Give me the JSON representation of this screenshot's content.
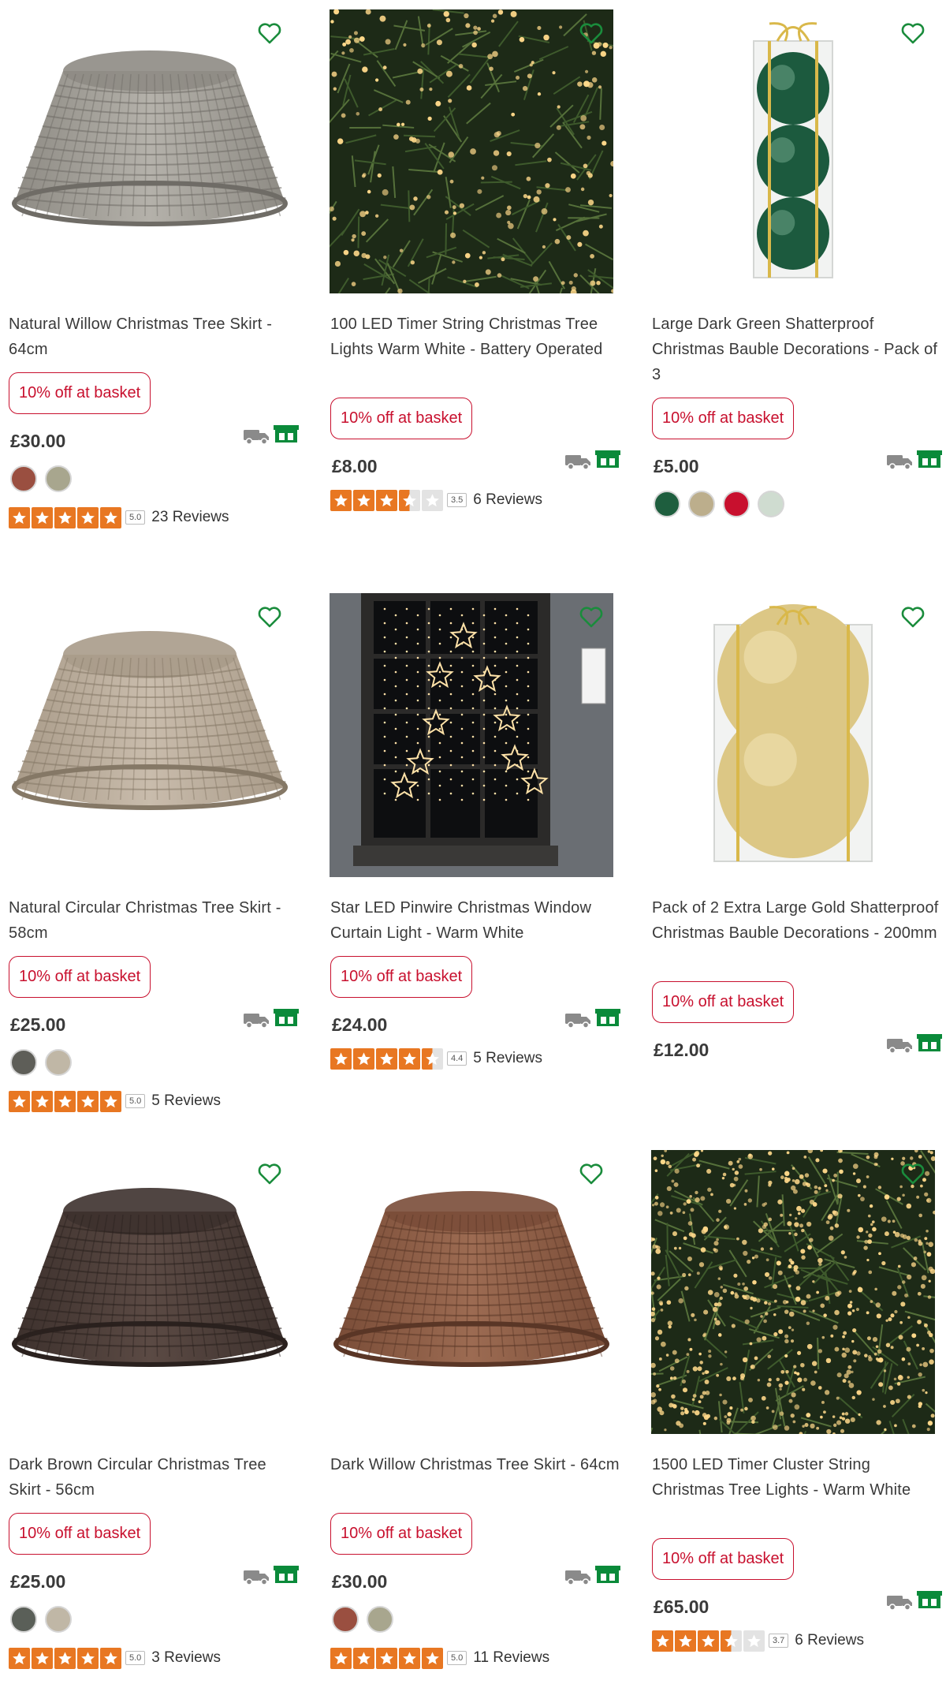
{
  "products": [
    {
      "title": "Natural Willow Christmas Tree Skirt - 64cm",
      "promo": "10% off at basket",
      "price": "£30.00",
      "swatches": [
        "#9a4f40",
        "#a8a68e"
      ],
      "rating": {
        "value": "5.0",
        "stars": 5,
        "reviews": "23 Reviews"
      },
      "image": "grey-wicker-skirt"
    },
    {
      "title": "100 LED Timer String Christmas Tree Lights Warm White - Battery Operated",
      "promo": "10% off at basket",
      "price": "£8.00",
      "swatches": [],
      "rating": {
        "value": "3.5",
        "stars": 3.5,
        "reviews": "6 Reviews"
      },
      "image": "tree-string-lights"
    },
    {
      "title": "Large Dark Green Shatterproof Christmas Bauble Decorations - Pack of 3",
      "promo": "10% off at basket",
      "price": "£5.00",
      "swatches": [
        "#1e5e3e",
        "#bcae8c",
        "#c8102e",
        "#cfdcd0"
      ],
      "rating": null,
      "image": "green-baubles-box"
    },
    {
      "title": "Natural Circular Christmas Tree Skirt - 58cm",
      "promo": "10% off at basket",
      "price": "£25.00",
      "swatches": [
        "#5e5e58",
        "#c0b7a6"
      ],
      "rating": {
        "value": "5.0",
        "stars": 5,
        "reviews": "5 Reviews"
      },
      "image": "natural-circular-skirt"
    },
    {
      "title": "Star LED Pinwire Christmas Window Curtain Light - Warm White",
      "promo": "10% off at basket",
      "price": "£24.00",
      "swatches": [],
      "rating": {
        "value": "4.4",
        "stars": 4.5,
        "reviews": "5 Reviews"
      },
      "image": "star-window-lights"
    },
    {
      "title": "Pack of 2 Extra Large Gold Shatterproof Christmas Bauble Decorations - 200mm",
      "promo": "10% off at basket",
      "price": "£12.00",
      "swatches": [],
      "rating": null,
      "image": "gold-baubles-box"
    },
    {
      "title": "Dark Brown Circular Christmas Tree Skirt - 56cm",
      "promo": "10% off at basket",
      "price": "£25.00",
      "swatches": [
        "#5a5f58",
        "#c0b7a6"
      ],
      "rating": {
        "value": "5.0",
        "stars": 5,
        "reviews": "3 Reviews"
      },
      "image": "dark-brown-skirt"
    },
    {
      "title": "Dark Willow Christmas Tree Skirt - 64cm",
      "promo": "10% off at basket",
      "price": "£30.00",
      "swatches": [
        "#9a4f40",
        "#a8a68e"
      ],
      "rating": {
        "value": "5.0",
        "stars": 5,
        "reviews": "11 Reviews"
      },
      "image": "dark-willow-skirt"
    },
    {
      "title": "1500 LED Timer Cluster String Christmas Tree Lights - Warm White",
      "promo": "10% off at basket",
      "price": "£65.00",
      "swatches": [],
      "rating": {
        "value": "3.7",
        "stars": 3.5,
        "reviews": "6 Reviews"
      },
      "image": "cluster-tree-lights"
    }
  ],
  "colors": {
    "promo": "#c8102e",
    "star": "#e87722",
    "heart": "#1a8c3c",
    "collect": "#0a8a3a",
    "delivery": "#8a8a8a"
  },
  "icons": {
    "wishlist": "heart-outline-icon",
    "delivery": "delivery-van-icon",
    "collect": "click-and-collect-icon",
    "star": "star-icon"
  }
}
